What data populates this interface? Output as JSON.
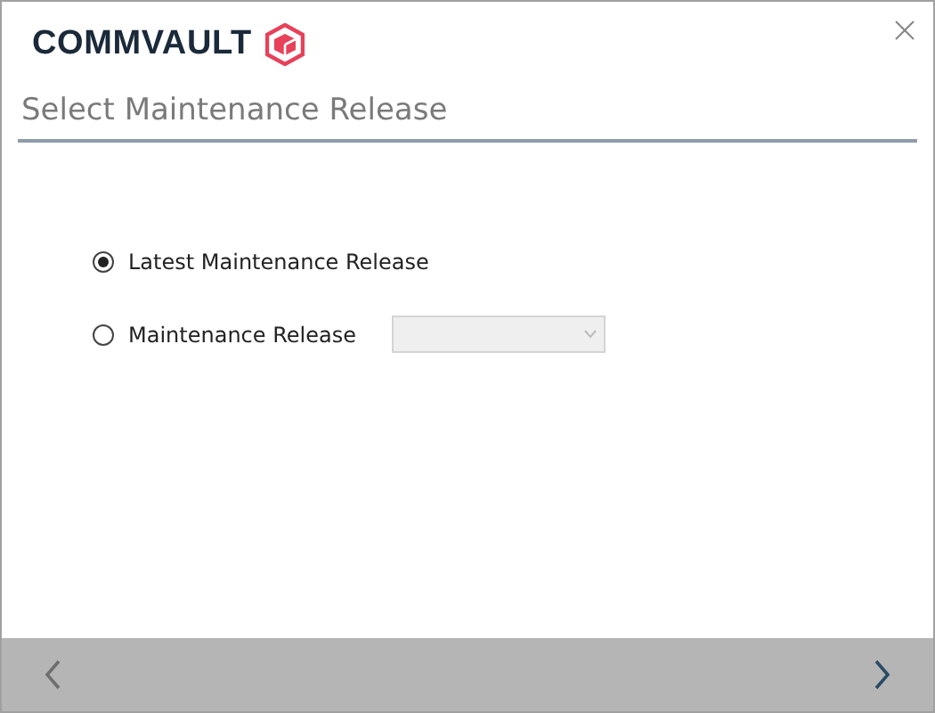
{
  "logo": {
    "text": "COMMVAULT"
  },
  "title": "Select Maintenance Release",
  "options": [
    {
      "label": "Latest Maintenance Release",
      "selected": true,
      "kind": "plain"
    },
    {
      "label": "Maintenance Release",
      "selected": false,
      "kind": "dropdown",
      "dropdown": {
        "disabled": true
      }
    }
  ],
  "footer": {
    "back": {
      "disabled": true
    },
    "next": {
      "disabled": false
    }
  }
}
